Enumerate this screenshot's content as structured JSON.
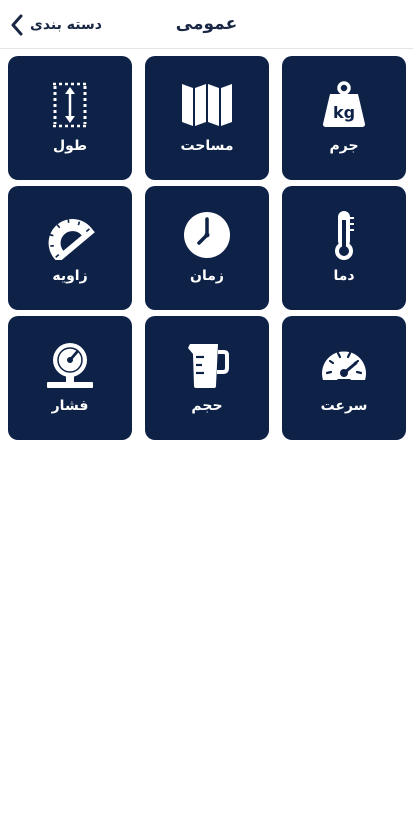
{
  "header": {
    "title": "عمومی",
    "back_label": "دسته بندی",
    "back_icon": "chevron-left-icon"
  },
  "colors": {
    "tile_background": "#0e2147",
    "tile_text": "#ffffff",
    "header_text": "#1a2744"
  },
  "tiles": [
    {
      "label": "جرم",
      "icon": "weight-kg-icon"
    },
    {
      "label": "مساحت",
      "icon": "folded-map-icon"
    },
    {
      "label": "طول",
      "icon": "length-measure-icon"
    },
    {
      "label": "دما",
      "icon": "thermometer-icon"
    },
    {
      "label": "زمان",
      "icon": "clock-icon"
    },
    {
      "label": "زاویه",
      "icon": "protractor-icon"
    },
    {
      "label": "سرعت",
      "icon": "speedometer-icon"
    },
    {
      "label": "حجم",
      "icon": "measuring-jug-icon"
    },
    {
      "label": "فشار",
      "icon": "pressure-gauge-icon"
    }
  ],
  "icon_texts": {
    "weight": "kg"
  }
}
